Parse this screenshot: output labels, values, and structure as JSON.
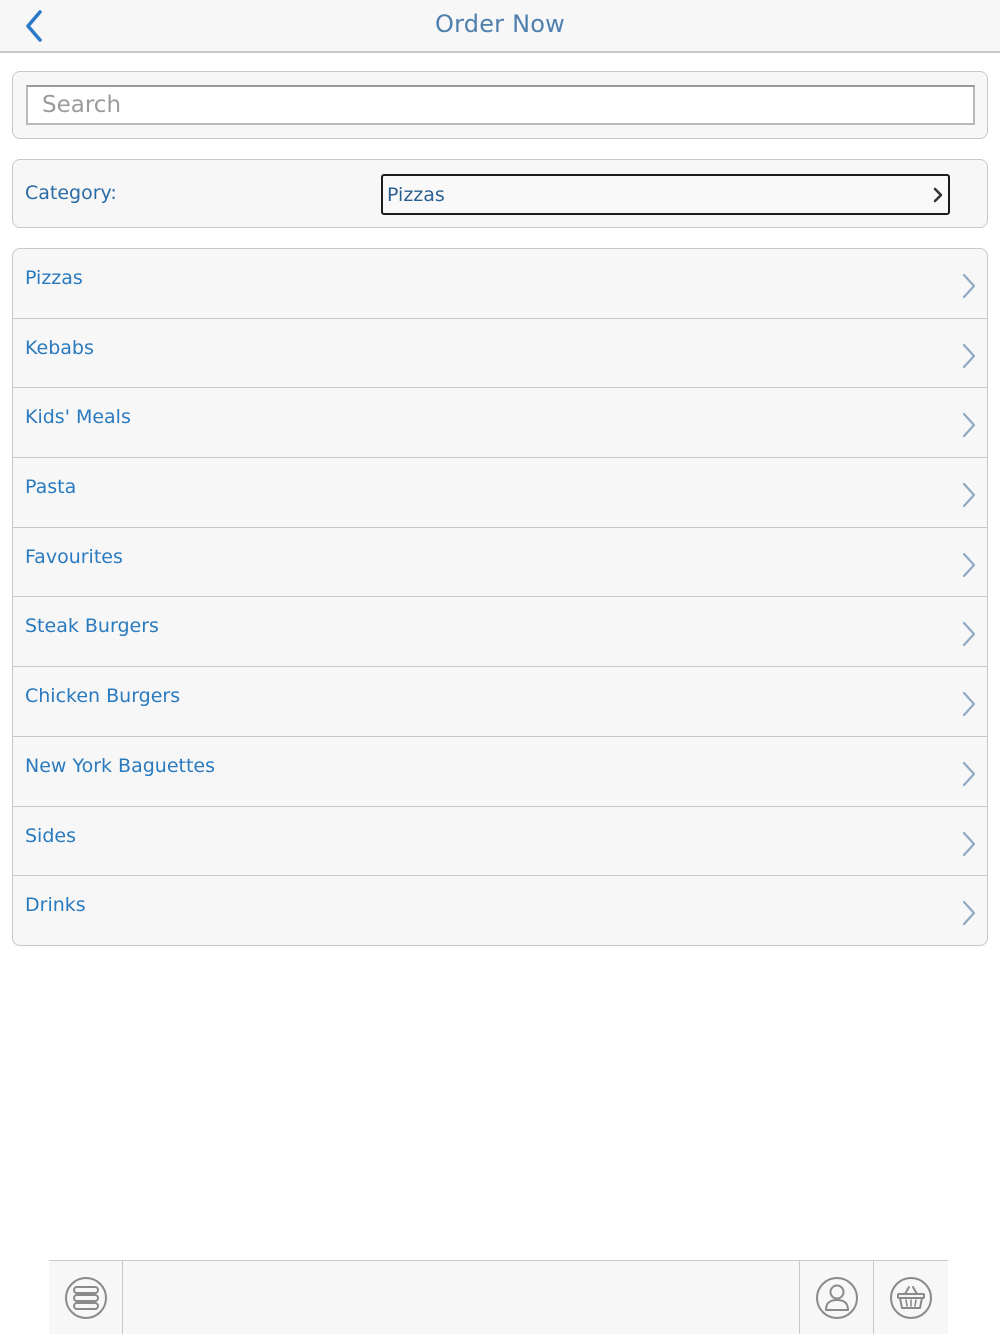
{
  "header": {
    "title": "Order Now",
    "back_icon": "chevron-left-icon"
  },
  "search": {
    "placeholder": "Search",
    "value": ""
  },
  "category": {
    "label": "Category:",
    "selected": "Pizzas"
  },
  "menu_items": [
    {
      "label": "Pizzas"
    },
    {
      "label": "Kebabs"
    },
    {
      "label": "Kids' Meals"
    },
    {
      "label": "Pasta"
    },
    {
      "label": "Favourites"
    },
    {
      "label": "Steak Burgers"
    },
    {
      "label": "Chicken Burgers"
    },
    {
      "label": "New York Baguettes"
    },
    {
      "label": "Sides"
    },
    {
      "label": "Drinks"
    }
  ],
  "bottom_bar": {
    "icons": [
      "menu-stack-icon",
      "account-icon",
      "basket-icon"
    ]
  },
  "colors": {
    "accent_blue": "#2a7ac0",
    "title_blue": "#4f7fad",
    "chevron_gray_blue": "#8fa9c4",
    "border_gray": "#c8c8c8",
    "panel_background": "#f7f7f7"
  }
}
